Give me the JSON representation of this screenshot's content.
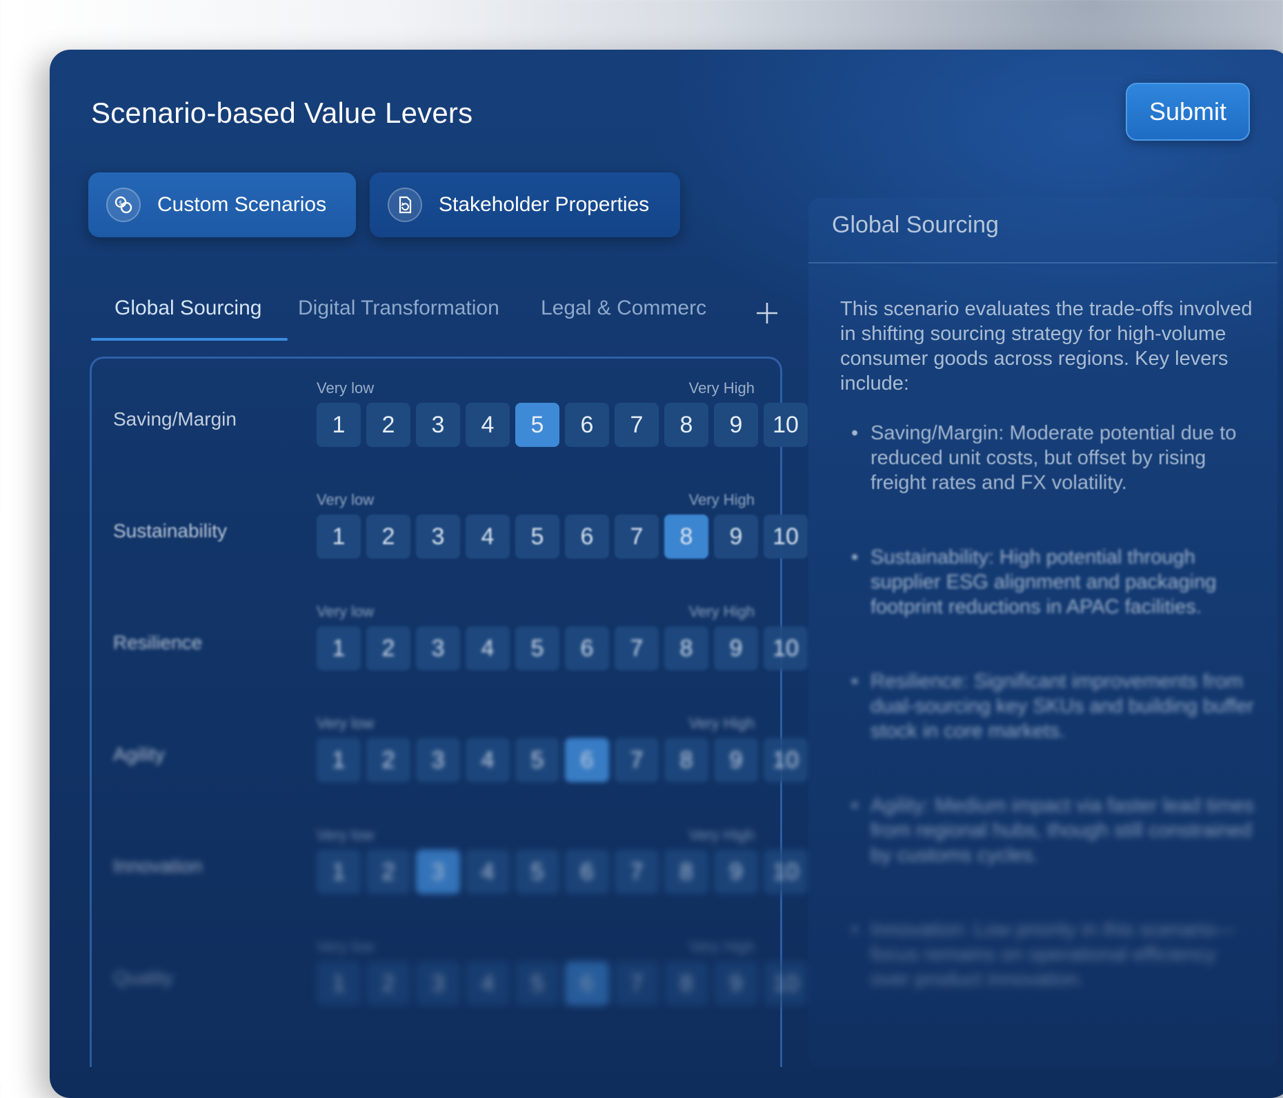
{
  "header": {
    "title": "Scenario-based Value Levers",
    "submit_label": "Submit"
  },
  "modes": [
    {
      "label": "Custom Scenarios",
      "icon": "coins-icon",
      "active": true
    },
    {
      "label": "Stakeholder Properties",
      "icon": "document-refresh-icon",
      "active": false
    }
  ],
  "tabs": [
    {
      "label": "Global Sourcing",
      "active": true
    },
    {
      "label": "Digital Transformation",
      "active": false
    },
    {
      "label": "Legal & Commerc",
      "active": false
    }
  ],
  "scale": {
    "low": "Very low",
    "high": "Very High",
    "values": [
      "1",
      "2",
      "3",
      "4",
      "5",
      "6",
      "7",
      "8",
      "9",
      "10"
    ]
  },
  "levers": [
    {
      "name": "Saving/Margin",
      "selected": 5
    },
    {
      "name": "Sustainability",
      "selected": 8
    },
    {
      "name": "Resilience",
      "selected": null
    },
    {
      "name": "Agility",
      "selected": 6
    },
    {
      "name": "Innovation",
      "selected": 3
    },
    {
      "name": "Quality",
      "selected": 6
    }
  ],
  "detail": {
    "title": "Global Sourcing",
    "intro": "This scenario evaluates the trade-offs involved in shifting sourcing strategy for high-volume consumer goods across regions.  Key levers include:",
    "bullets": [
      "Saving/Margin:  Moderate potential due to reduced unit costs, but offset by rising freight rates and FX volatility.",
      "Sustainability:  High potential through supplier ESG alignment and packaging footprint reductions in APAC facilities.",
      "Resilience:  Significant improvements from dual-sourcing key SKUs and building buffer stock in core markets.",
      "Agility:  Medium impact via faster lead times from regional hubs, though still constrained by customs cycles.",
      "Innovation:  Low priority in this scenario—focus remains on operational efficiency over product innovation."
    ]
  },
  "colors": {
    "accent": "#3f8ad6",
    "panel": "#123569",
    "cell": "#1f4a80"
  }
}
